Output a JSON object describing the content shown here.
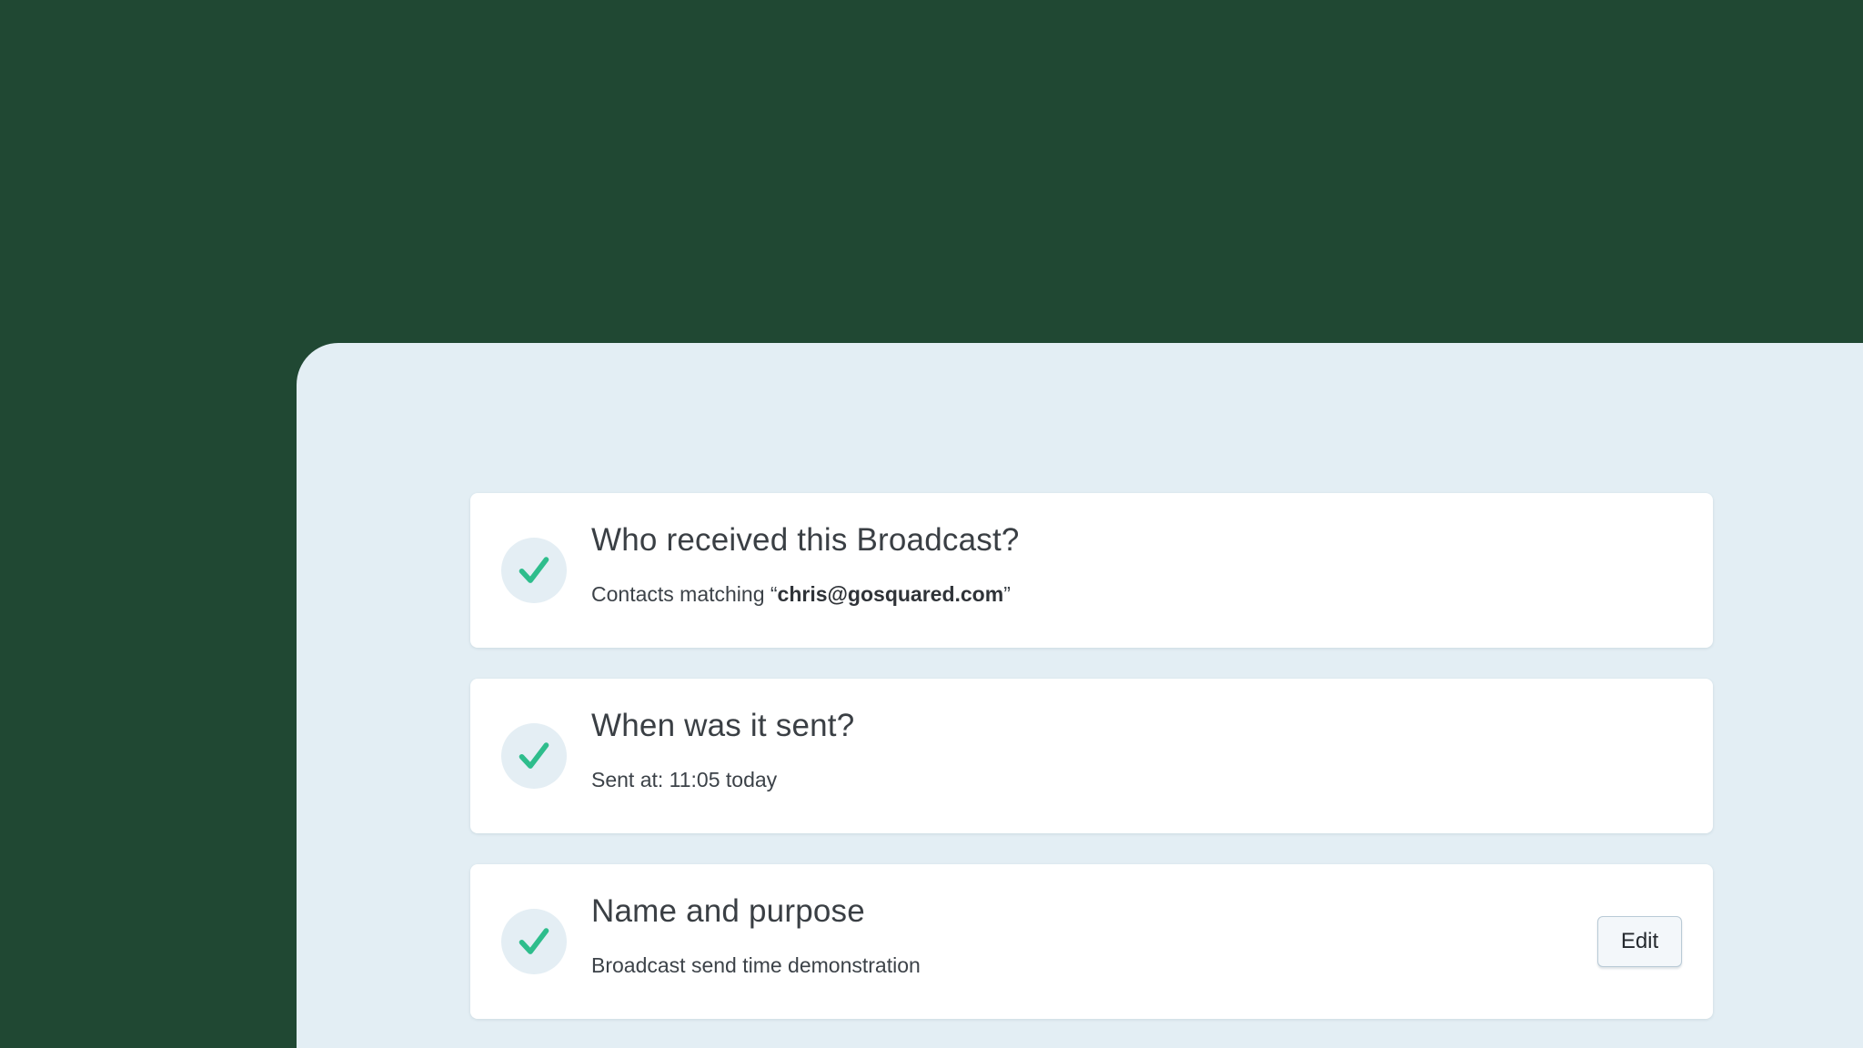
{
  "colors": {
    "background": "#204833",
    "panel": "#e3eef4",
    "card": "#ffffff",
    "check_accent": "#2ebd8c",
    "check_circle": "#e4eef4"
  },
  "steps": [
    {
      "title": "Who received this Broadcast?",
      "subtitle_prefix": "Contacts matching “",
      "subtitle_highlight": "chris@gosquared.com",
      "subtitle_suffix": "”",
      "status_icon": "check-icon"
    },
    {
      "title": "When was it sent?",
      "subtitle": "Sent at: 11:05 today",
      "status_icon": "check-icon"
    },
    {
      "title": "Name and purpose",
      "subtitle": "Broadcast send time demonstration",
      "status_icon": "check-icon",
      "edit_label": "Edit"
    }
  ]
}
